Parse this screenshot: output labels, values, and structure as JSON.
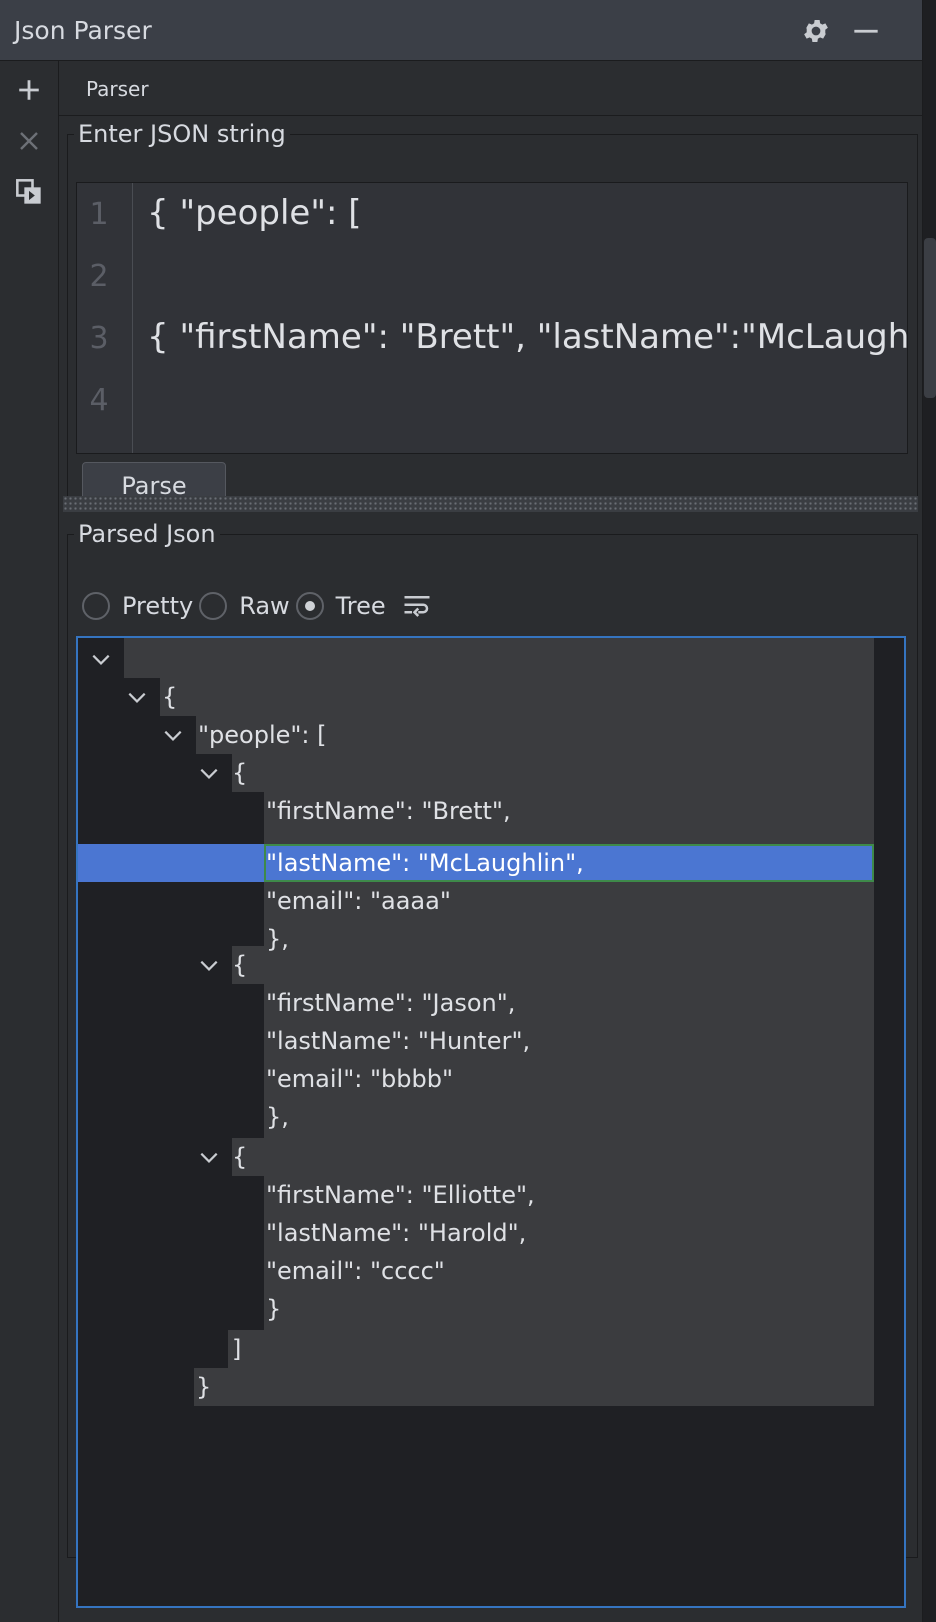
{
  "window": {
    "title": "Json Parser",
    "icons": {
      "settings": "gear-icon",
      "minimize": "minus-icon"
    }
  },
  "left_toolbar": {
    "add": "plus-icon",
    "close": "close-icon",
    "restore": "restore-tab-icon"
  },
  "tab": {
    "label": "Parser"
  },
  "input_section": {
    "legend": "Enter JSON string",
    "lines": [
      {
        "number": "1",
        "text": "{ \"people\": ["
      },
      {
        "number": "2",
        "text": ""
      },
      {
        "number": "3",
        "text": "{ \"firstName\": \"Brett\", \"lastName\":\"McLaugh"
      },
      {
        "number": "4",
        "text": ""
      }
    ],
    "parse_button": "Parse"
  },
  "output_section": {
    "legend": "Parsed Json",
    "view_modes": [
      {
        "label": "Pretty",
        "selected": false
      },
      {
        "label": "Raw",
        "selected": false
      },
      {
        "label": "Tree",
        "selected": true
      }
    ],
    "wrap_icon": "soft-wrap-icon",
    "tree_rows": [
      "",
      "{",
      "\"people\": [",
      "{",
      "\"firstName\": \"Brett\",",
      "\"lastName\": \"McLaughlin\",",
      "\"email\": \"aaaa\"",
      "},",
      "{",
      "\"firstName\": \"Jason\",",
      "\"lastName\": \"Hunter\",",
      "\"email\": \"bbbb\"",
      "},",
      "{",
      "\"firstName\": \"Elliotte\",",
      "\"lastName\": \"Harold\",",
      "\"email\": \"cccc\"",
      "}",
      "]",
      "}"
    ],
    "selected_row": "\"lastName\": \"McLaughlin\","
  },
  "colors": {
    "selection": "#4b76d2",
    "focus_border": "#3574c0",
    "row_background": "#3b3c3f"
  }
}
